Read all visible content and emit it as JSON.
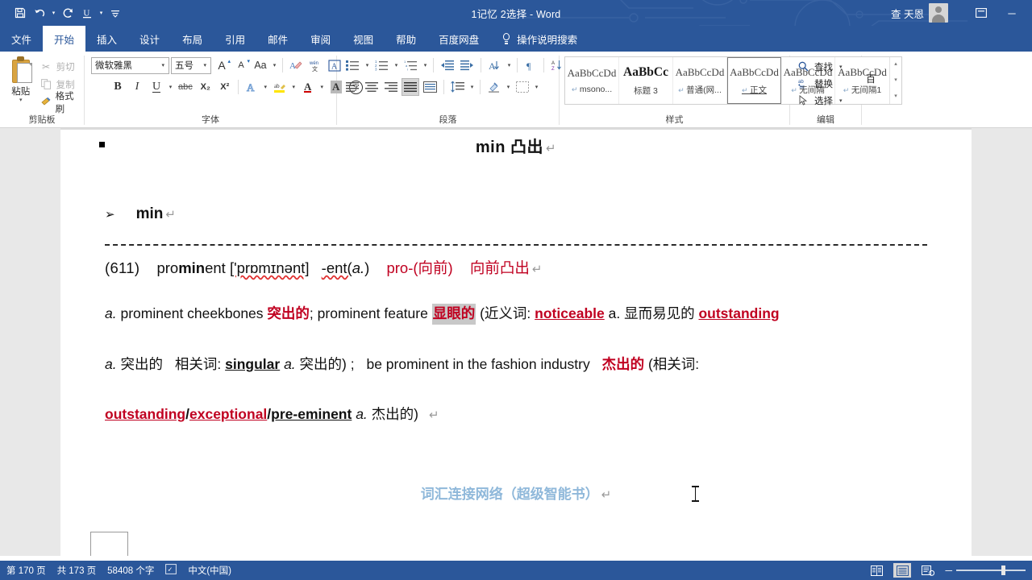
{
  "titlebar": {
    "quick_access": [
      {
        "name": "save",
        "glyph": "Ὃe"
      },
      {
        "name": "undo",
        "glyph": "↶"
      },
      {
        "name": "redo",
        "glyph": "↻"
      },
      {
        "name": "underline",
        "glyph": "U"
      },
      {
        "name": "customize",
        "glyph": "☰"
      }
    ],
    "document_title": "1记忆 2选择  -  Word",
    "account_name": "查 天恩",
    "ribbon_display_label": "☰",
    "minimize_label": "─"
  },
  "tabs": [
    {
      "label": "文件",
      "active": false
    },
    {
      "label": "开始",
      "active": true
    },
    {
      "label": "插入",
      "active": false
    },
    {
      "label": "设计",
      "active": false
    },
    {
      "label": "布局",
      "active": false
    },
    {
      "label": "引用",
      "active": false
    },
    {
      "label": "邮件",
      "active": false
    },
    {
      "label": "审阅",
      "active": false
    },
    {
      "label": "视图",
      "active": false
    },
    {
      "label": "帮助",
      "active": false
    },
    {
      "label": "百度网盘",
      "active": false
    }
  ],
  "tell_me": "操作说明搜索",
  "ribbon": {
    "clipboard": {
      "group_label": "剪贴板",
      "paste_label": "粘贴",
      "cut_label": "剪切",
      "copy_label": "复制",
      "format_painter_label": "格式刷"
    },
    "font": {
      "group_label": "字体",
      "font_name": "微软雅黑",
      "font_size": "五号",
      "grow_font": "A",
      "shrink_font": "A",
      "change_case": "Aa",
      "clear_formatting": "clear-formatting-icon",
      "phonetic_guide": "拼音指南",
      "character_border": "A",
      "bold": "B",
      "italic": "I",
      "underline": "U",
      "strikethrough": "abc",
      "subscript": "X₂",
      "superscript": "X²",
      "text_effects": "A",
      "text_highlight": "ab",
      "font_color": "A",
      "char_shading": "A",
      "enclose_char": "字"
    },
    "paragraph": {
      "group_label": "段落",
      "bullets": "bullets-icon",
      "numbering": "numbering-icon",
      "multilevel": "multilevel-list-icon",
      "decrease_indent": "decrease-indent-icon",
      "increase_indent": "increase-indent-icon",
      "sort": "sort-icon",
      "show_marks": "show-formatting-marks-icon",
      "align_left": "align-left-icon",
      "align_center": "align-center-icon",
      "align_right": "align-right-icon",
      "justify": "justify-icon",
      "distribute": "distribute-icon",
      "line_spacing": "line-spacing-icon",
      "shading": "shading-icon",
      "borders": "borders-icon"
    },
    "styles": {
      "group_label": "样式",
      "items": [
        {
          "preview": "AaBbCcDd",
          "name": "msono...",
          "selected": false,
          "bold": false,
          "mark": "↵"
        },
        {
          "preview": "AaBbCc",
          "name": "标题 3",
          "selected": false,
          "bold": true,
          "mark": ""
        },
        {
          "preview": "AaBbCcDd",
          "name": "普通(网...",
          "selected": false,
          "bold": false,
          "mark": "↵"
        },
        {
          "preview": "AaBbCcDd",
          "name": "正文",
          "selected": true,
          "bold": false,
          "mark": "↵"
        },
        {
          "preview": "AaBbCcDd",
          "name": "无间隔",
          "selected": false,
          "bold": false,
          "mark": "↵"
        },
        {
          "preview": "AaBbCcDd",
          "name": "无间隔1",
          "selected": false,
          "bold": false,
          "mark": "↵"
        }
      ]
    },
    "editing": {
      "group_label": "编辑",
      "find_label": "查找",
      "replace_label": "替换",
      "select_label": "选择"
    },
    "baidu_label": "百"
  },
  "document": {
    "heading_bullet_line": "min  凸出",
    "sub_heading": "min",
    "entry": {
      "number": "(611)",
      "word": "prominent",
      "word_bold_part": "min",
      "phonetic": "['prɒmɪnənt]",
      "suffix": "-ent(",
      "suffix_italic": "a.",
      "suffix_close": ")",
      "prefix_gloss": "pro-(向前)",
      "meaning_gloss": "向前凸出"
    },
    "body": {
      "line1": {
        "pos": "a.",
        "text1": "prominent cheekbones",
        "gloss1": "突出的",
        "sep1": ";",
        "text2": "prominent feature",
        "gloss2_highlighted": "显眼的",
        "paren_open": "(近义词:",
        "syn1": "noticeable",
        "syn1_pos": "a.",
        "syn1_gloss": "显而易见的",
        "syn2": "outstanding"
      },
      "line2": {
        "pos": "a.",
        "gloss": "突出的",
        "related_label": "相关词:",
        "related_word": "singular",
        "related_pos": "a.",
        "related_gloss": "突出的) ;",
        "phrase": "be  prominent  in the  fashion  industry",
        "phrase_gloss": "杰出的",
        "paren2": "(相关词:"
      },
      "line3": {
        "syn_a": "outstanding",
        "slash1": "/",
        "syn_b": "exceptional",
        "slash2": "/",
        "syn_c": "pre-eminent",
        "pos": "a.",
        "gloss": "杰出的)"
      }
    },
    "footer_note": "词汇连接网络（超级智能书）",
    "pilcrow": "↵"
  },
  "status": {
    "page_info": "第 170 页",
    "page_total": "共 173 页",
    "word_count": "58408 个字",
    "proofing_icon": "proofing-errors-icon",
    "language": "中文(中国)",
    "view_read": "read-mode-icon",
    "view_print": "print-layout-icon",
    "view_web": "web-layout-icon",
    "zoom_out": "─",
    "zoom_in": "+"
  },
  "colors": {
    "word_blue": "#2b579a",
    "accent_red": "#c00020",
    "footer_blue": "#8fb8da",
    "highlight_gray": "#c8c8c8"
  }
}
